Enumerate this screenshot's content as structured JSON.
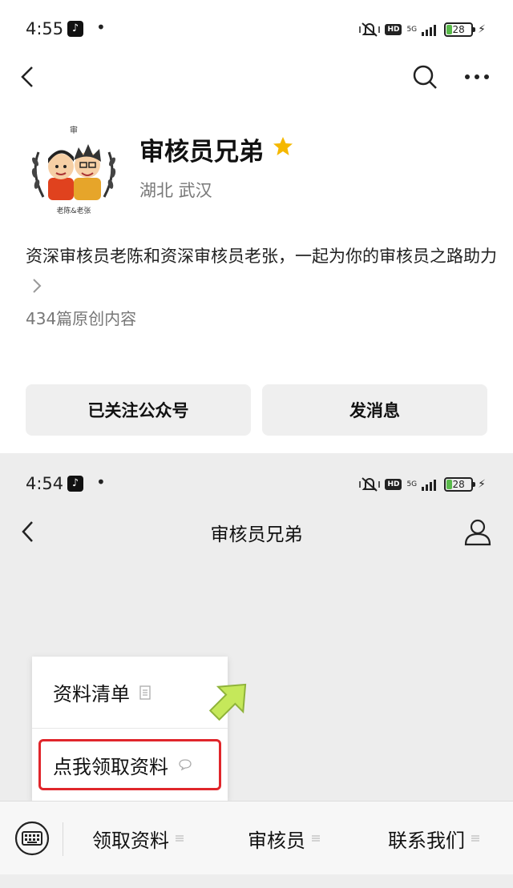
{
  "top_screen": {
    "status": {
      "time": "4:55",
      "hd_badge": "HD",
      "network": "5G",
      "battery": "28",
      "battery_level": 0.28
    },
    "account": {
      "name": "审核员兄弟",
      "location": "湖北 武汉",
      "avatar_text_top": "审",
      "avatar_text_bottom": "老陈&老张",
      "description": "资深审核员老陈和资深审核员老张，一起为你的审核员之路助力",
      "article_count": "434篇原创内容"
    },
    "buttons": {
      "followed": "已关注公众号",
      "message": "发消息"
    },
    "icons": {
      "back": "chevron-left-icon",
      "search": "search-icon",
      "more": "more-icon",
      "star": "star-icon"
    },
    "colors": {
      "star": "#f5b800"
    }
  },
  "bottom_screen": {
    "status": {
      "time": "4:54",
      "hd_badge": "HD",
      "network": "5G",
      "battery": "28",
      "battery_level": 0.28
    },
    "chat": {
      "title": "审核员兄弟"
    },
    "popup": {
      "items": [
        {
          "label": "资料清单",
          "icon": "document-icon"
        },
        {
          "label": "点我领取资料",
          "icon": "chat-bubble-icon"
        }
      ]
    },
    "menu": {
      "items": [
        {
          "label": "领取资料"
        },
        {
          "label": "审核员"
        },
        {
          "label": "联系我们"
        }
      ]
    },
    "colors": {
      "highlight": "#e0262b",
      "arrow": "#b5e04a"
    }
  }
}
